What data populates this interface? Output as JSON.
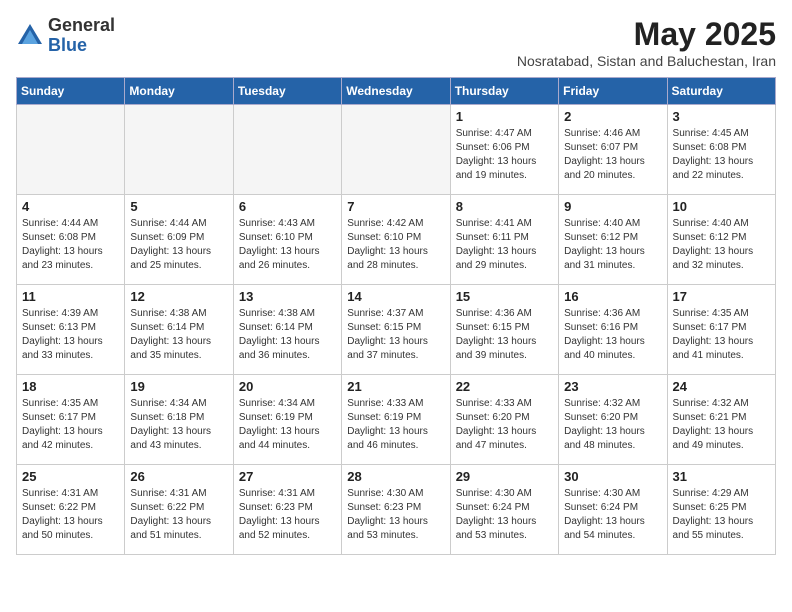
{
  "logo": {
    "general": "General",
    "blue": "Blue"
  },
  "title": "May 2025",
  "location": "Nosratabad, Sistan and Baluchestan, Iran",
  "days_of_week": [
    "Sunday",
    "Monday",
    "Tuesday",
    "Wednesday",
    "Thursday",
    "Friday",
    "Saturday"
  ],
  "weeks": [
    [
      {
        "day": "",
        "info": ""
      },
      {
        "day": "",
        "info": ""
      },
      {
        "day": "",
        "info": ""
      },
      {
        "day": "",
        "info": ""
      },
      {
        "day": "1",
        "info": "Sunrise: 4:47 AM\nSunset: 6:06 PM\nDaylight: 13 hours\nand 19 minutes."
      },
      {
        "day": "2",
        "info": "Sunrise: 4:46 AM\nSunset: 6:07 PM\nDaylight: 13 hours\nand 20 minutes."
      },
      {
        "day": "3",
        "info": "Sunrise: 4:45 AM\nSunset: 6:08 PM\nDaylight: 13 hours\nand 22 minutes."
      }
    ],
    [
      {
        "day": "4",
        "info": "Sunrise: 4:44 AM\nSunset: 6:08 PM\nDaylight: 13 hours\nand 23 minutes."
      },
      {
        "day": "5",
        "info": "Sunrise: 4:44 AM\nSunset: 6:09 PM\nDaylight: 13 hours\nand 25 minutes."
      },
      {
        "day": "6",
        "info": "Sunrise: 4:43 AM\nSunset: 6:10 PM\nDaylight: 13 hours\nand 26 minutes."
      },
      {
        "day": "7",
        "info": "Sunrise: 4:42 AM\nSunset: 6:10 PM\nDaylight: 13 hours\nand 28 minutes."
      },
      {
        "day": "8",
        "info": "Sunrise: 4:41 AM\nSunset: 6:11 PM\nDaylight: 13 hours\nand 29 minutes."
      },
      {
        "day": "9",
        "info": "Sunrise: 4:40 AM\nSunset: 6:12 PM\nDaylight: 13 hours\nand 31 minutes."
      },
      {
        "day": "10",
        "info": "Sunrise: 4:40 AM\nSunset: 6:12 PM\nDaylight: 13 hours\nand 32 minutes."
      }
    ],
    [
      {
        "day": "11",
        "info": "Sunrise: 4:39 AM\nSunset: 6:13 PM\nDaylight: 13 hours\nand 33 minutes."
      },
      {
        "day": "12",
        "info": "Sunrise: 4:38 AM\nSunset: 6:14 PM\nDaylight: 13 hours\nand 35 minutes."
      },
      {
        "day": "13",
        "info": "Sunrise: 4:38 AM\nSunset: 6:14 PM\nDaylight: 13 hours\nand 36 minutes."
      },
      {
        "day": "14",
        "info": "Sunrise: 4:37 AM\nSunset: 6:15 PM\nDaylight: 13 hours\nand 37 minutes."
      },
      {
        "day": "15",
        "info": "Sunrise: 4:36 AM\nSunset: 6:15 PM\nDaylight: 13 hours\nand 39 minutes."
      },
      {
        "day": "16",
        "info": "Sunrise: 4:36 AM\nSunset: 6:16 PM\nDaylight: 13 hours\nand 40 minutes."
      },
      {
        "day": "17",
        "info": "Sunrise: 4:35 AM\nSunset: 6:17 PM\nDaylight: 13 hours\nand 41 minutes."
      }
    ],
    [
      {
        "day": "18",
        "info": "Sunrise: 4:35 AM\nSunset: 6:17 PM\nDaylight: 13 hours\nand 42 minutes."
      },
      {
        "day": "19",
        "info": "Sunrise: 4:34 AM\nSunset: 6:18 PM\nDaylight: 13 hours\nand 43 minutes."
      },
      {
        "day": "20",
        "info": "Sunrise: 4:34 AM\nSunset: 6:19 PM\nDaylight: 13 hours\nand 44 minutes."
      },
      {
        "day": "21",
        "info": "Sunrise: 4:33 AM\nSunset: 6:19 PM\nDaylight: 13 hours\nand 46 minutes."
      },
      {
        "day": "22",
        "info": "Sunrise: 4:33 AM\nSunset: 6:20 PM\nDaylight: 13 hours\nand 47 minutes."
      },
      {
        "day": "23",
        "info": "Sunrise: 4:32 AM\nSunset: 6:20 PM\nDaylight: 13 hours\nand 48 minutes."
      },
      {
        "day": "24",
        "info": "Sunrise: 4:32 AM\nSunset: 6:21 PM\nDaylight: 13 hours\nand 49 minutes."
      }
    ],
    [
      {
        "day": "25",
        "info": "Sunrise: 4:31 AM\nSunset: 6:22 PM\nDaylight: 13 hours\nand 50 minutes."
      },
      {
        "day": "26",
        "info": "Sunrise: 4:31 AM\nSunset: 6:22 PM\nDaylight: 13 hours\nand 51 minutes."
      },
      {
        "day": "27",
        "info": "Sunrise: 4:31 AM\nSunset: 6:23 PM\nDaylight: 13 hours\nand 52 minutes."
      },
      {
        "day": "28",
        "info": "Sunrise: 4:30 AM\nSunset: 6:23 PM\nDaylight: 13 hours\nand 53 minutes."
      },
      {
        "day": "29",
        "info": "Sunrise: 4:30 AM\nSunset: 6:24 PM\nDaylight: 13 hours\nand 53 minutes."
      },
      {
        "day": "30",
        "info": "Sunrise: 4:30 AM\nSunset: 6:24 PM\nDaylight: 13 hours\nand 54 minutes."
      },
      {
        "day": "31",
        "info": "Sunrise: 4:29 AM\nSunset: 6:25 PM\nDaylight: 13 hours\nand 55 minutes."
      }
    ]
  ]
}
